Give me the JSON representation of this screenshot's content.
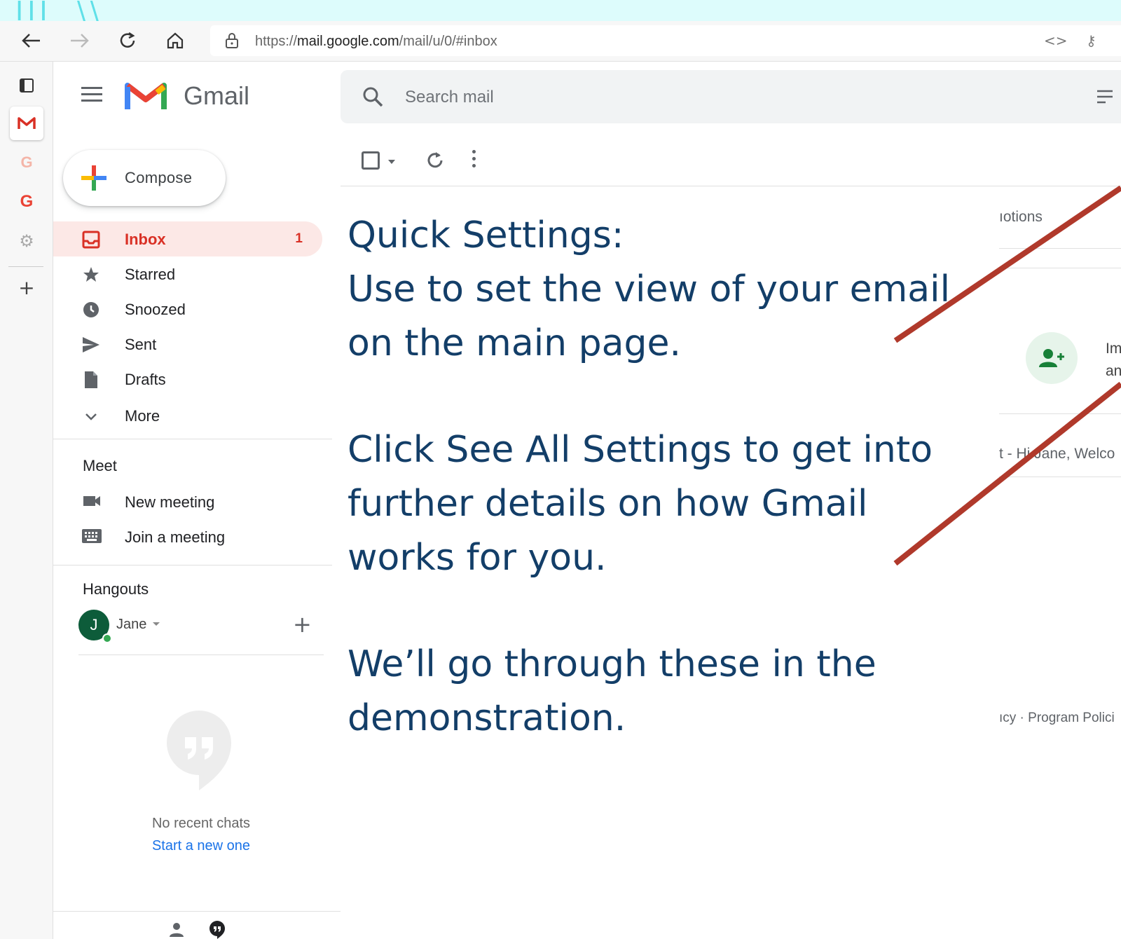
{
  "browser": {
    "url_prefix": "https://",
    "url_domain": "mail.google.com",
    "url_path": "/mail/u/0/#inbox"
  },
  "gmail": {
    "logo_text": "Gmail",
    "search_placeholder": "Search mail",
    "compose_label": "Compose",
    "nav": [
      {
        "label": "Inbox",
        "count": "1",
        "icon": "inbox-icon"
      },
      {
        "label": "Starred",
        "icon": "star-icon"
      },
      {
        "label": "Snoozed",
        "icon": "clock-icon"
      },
      {
        "label": "Sent",
        "icon": "send-icon"
      },
      {
        "label": "Drafts",
        "icon": "draft-icon"
      },
      {
        "label": "More",
        "icon": "chevron-down-icon"
      }
    ],
    "meet": {
      "heading": "Meet",
      "items": [
        {
          "label": "New meeting",
          "icon": "video-icon"
        },
        {
          "label": "Join a meeting",
          "icon": "keyboard-icon"
        }
      ]
    },
    "hangouts": {
      "heading": "Hangouts",
      "user_initial": "J",
      "user_name": "Jane",
      "no_chats": "No recent chats",
      "start_new": "Start a new one"
    },
    "right_partial": {
      "tab": "ıotions",
      "line1": "Im",
      "line2": "an",
      "snippet": "t - Hi Jane, Welco",
      "footer": "ıcy · Program Polici"
    }
  },
  "overlay": {
    "line1": "Quick Settings:",
    "line2": "Use to set the view of your email",
    "line3": "on the main page.",
    "line4": "Click See All Settings to get into",
    "line5": "further details on how Gmail",
    "line6": "works for you.",
    "line7": "We’ll go through these in the",
    "line8": "demonstration."
  },
  "colors": {
    "accent_red": "#d93025",
    "overlay_text": "#133e68",
    "arrow": "#b0392b",
    "teal_strip": "#ddfcfc"
  }
}
